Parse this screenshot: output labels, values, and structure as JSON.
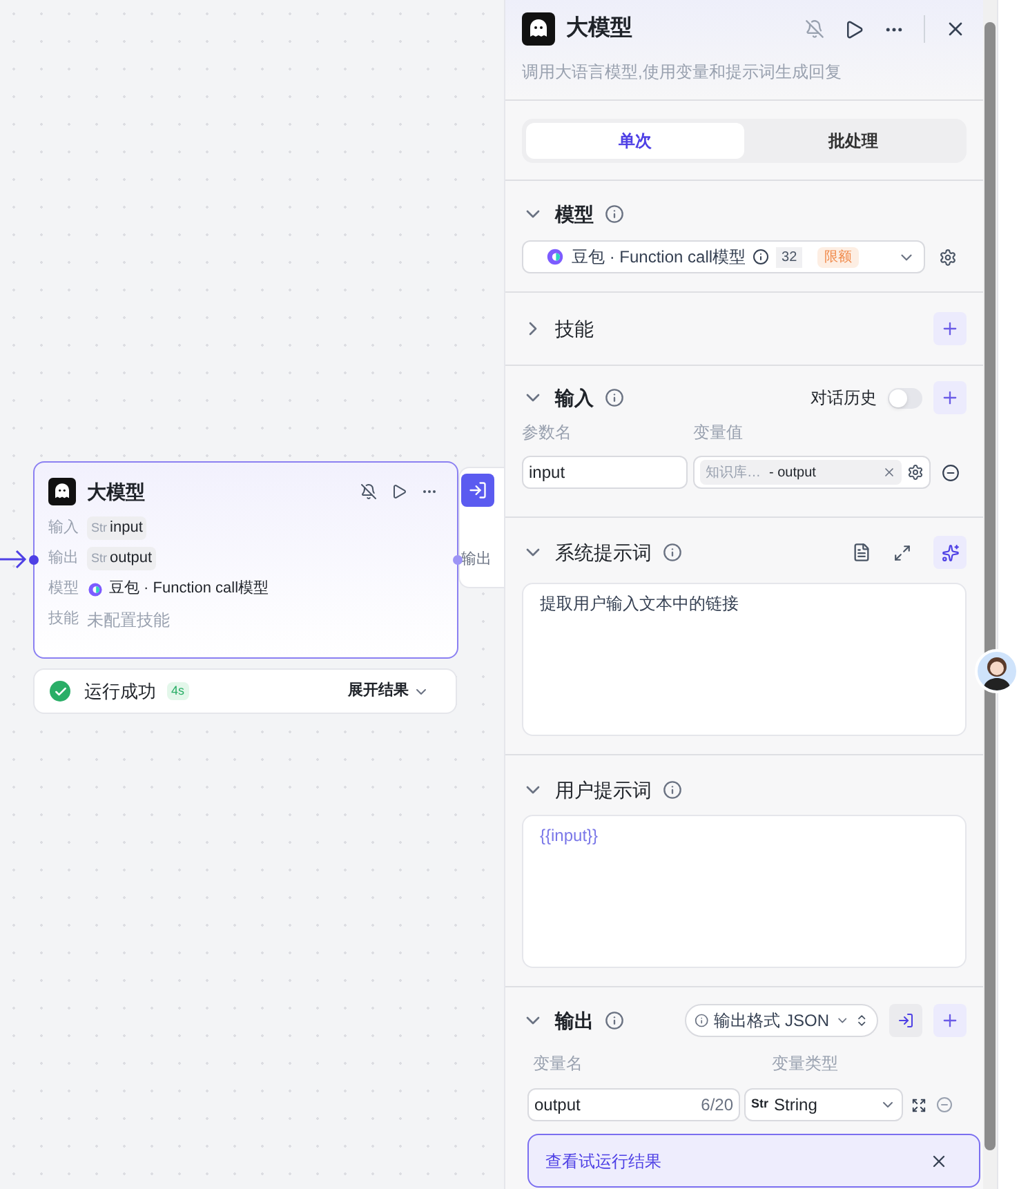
{
  "canvas": {
    "node": {
      "title": "大模型",
      "rows": [
        {
          "label": "输入",
          "kind": "var",
          "type": "Str",
          "value": "input"
        },
        {
          "label": "输出",
          "kind": "var",
          "type": "Str",
          "value": "output"
        },
        {
          "label": "模型",
          "kind": "model",
          "value": "豆包 · Function call模型"
        },
        {
          "label": "技能",
          "kind": "empty",
          "value": "未配置技能"
        }
      ],
      "status": {
        "text": "运行成功",
        "duration": "4s",
        "expand": "展开结果"
      }
    },
    "next_node": {
      "labels": [
        "输出"
      ]
    }
  },
  "panel": {
    "title": "大模型",
    "description": "调用大语言模型,使用变量和提示词生成回复",
    "tabs": [
      {
        "label": "单次",
        "selected": true
      },
      {
        "label": "批处理",
        "selected": false
      }
    ],
    "model": {
      "title": "模型",
      "expanded": true,
      "name": "豆包 · Function call模型",
      "context": "32",
      "quota": "限额"
    },
    "skills": {
      "title": "技能",
      "expanded": false
    },
    "input": {
      "title": "输入",
      "expanded": true,
      "history_label": "对话历史",
      "history_on": false,
      "columns": [
        "参数名",
        "变量值"
      ],
      "params": [
        {
          "name": "input",
          "source": "知识库…",
          "ref": "- output"
        }
      ]
    },
    "system_prompt": {
      "title": "系统提示词",
      "expanded": true,
      "text": "提取用户输入文本中的链接"
    },
    "user_prompt": {
      "title": "用户提示词",
      "expanded": true,
      "text": "{{input}}"
    },
    "output": {
      "title": "输出",
      "expanded": true,
      "format": "输出格式 JSON",
      "columns": [
        "变量名",
        "变量类型"
      ],
      "vars": [
        {
          "name": "output",
          "count": "6/20",
          "type_badge": "Str",
          "type": "String"
        }
      ]
    },
    "toast": "查看试运行结果"
  }
}
